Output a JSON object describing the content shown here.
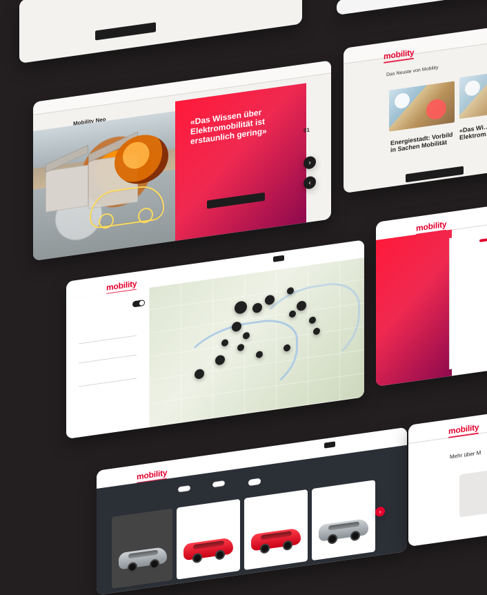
{
  "domain": "Computer-Use",
  "colors": {
    "background": "#231f20",
    "brand_red": "#e3002d",
    "ink": "#1c1c1c",
    "paper": "#f3f2ef",
    "map_pin": "#202020"
  },
  "brand": {
    "logo_text": "mobility"
  },
  "cards": {
    "hero": {
      "section_title": "Mobility Neo",
      "quote": "«Das Wissen über Elektromobilität ist erstaunlich gering»",
      "paragraph": "",
      "cta_label": "",
      "pager_text": "01",
      "nav_items": [
        "",
        "",
        "",
        "",
        ""
      ]
    },
    "news": {
      "title": "Das Neuste von Mobility",
      "headline_1": "Energiestadt: Vorbild in Sachen Mobilität",
      "headline_2": "«Das Wi… Elektrom… erstaun…",
      "cta_label": ""
    },
    "map": {
      "nav_items": [
        "",
        "",
        "",
        ""
      ],
      "cta_label": "",
      "toggle_label": "",
      "field_1_label": "",
      "field_1_value": "",
      "field_2_label": "",
      "field_2_value": "",
      "field_3_label": "",
      "field_3_value": "",
      "link_label": "",
      "pins": [
        {
          "label": "",
          "size": "lg"
        },
        {
          "label": "",
          "size": "md"
        },
        {
          "label": "",
          "size": "md"
        },
        {
          "label": "",
          "size": "sm"
        },
        {
          "label": "",
          "size": "md"
        },
        {
          "label": "",
          "size": "sm"
        },
        {
          "label": "",
          "size": "md"
        },
        {
          "label": "",
          "size": "sm"
        },
        {
          "label": "",
          "size": "sm"
        },
        {
          "label": "",
          "size": "md"
        },
        {
          "label": "",
          "size": "sm"
        },
        {
          "label": "",
          "size": "sm"
        },
        {
          "label": "",
          "size": "sm"
        },
        {
          "label": "",
          "size": "sm"
        },
        {
          "label": "",
          "size": "sm"
        },
        {
          "label": "",
          "size": "md"
        }
      ]
    },
    "form": {
      "logo_text": "mobility"
    },
    "vehicles": {
      "filter_1": "",
      "filter_2": "",
      "toggle_text": "",
      "nav_items": [
        "",
        "",
        "",
        ""
      ],
      "cta_label": "",
      "vehicle_tags": [
        "",
        "",
        "",
        ""
      ],
      "vehicle_names": [
        "",
        "",
        "",
        ""
      ]
    },
    "more": {
      "title": "Mehr über M"
    }
  }
}
